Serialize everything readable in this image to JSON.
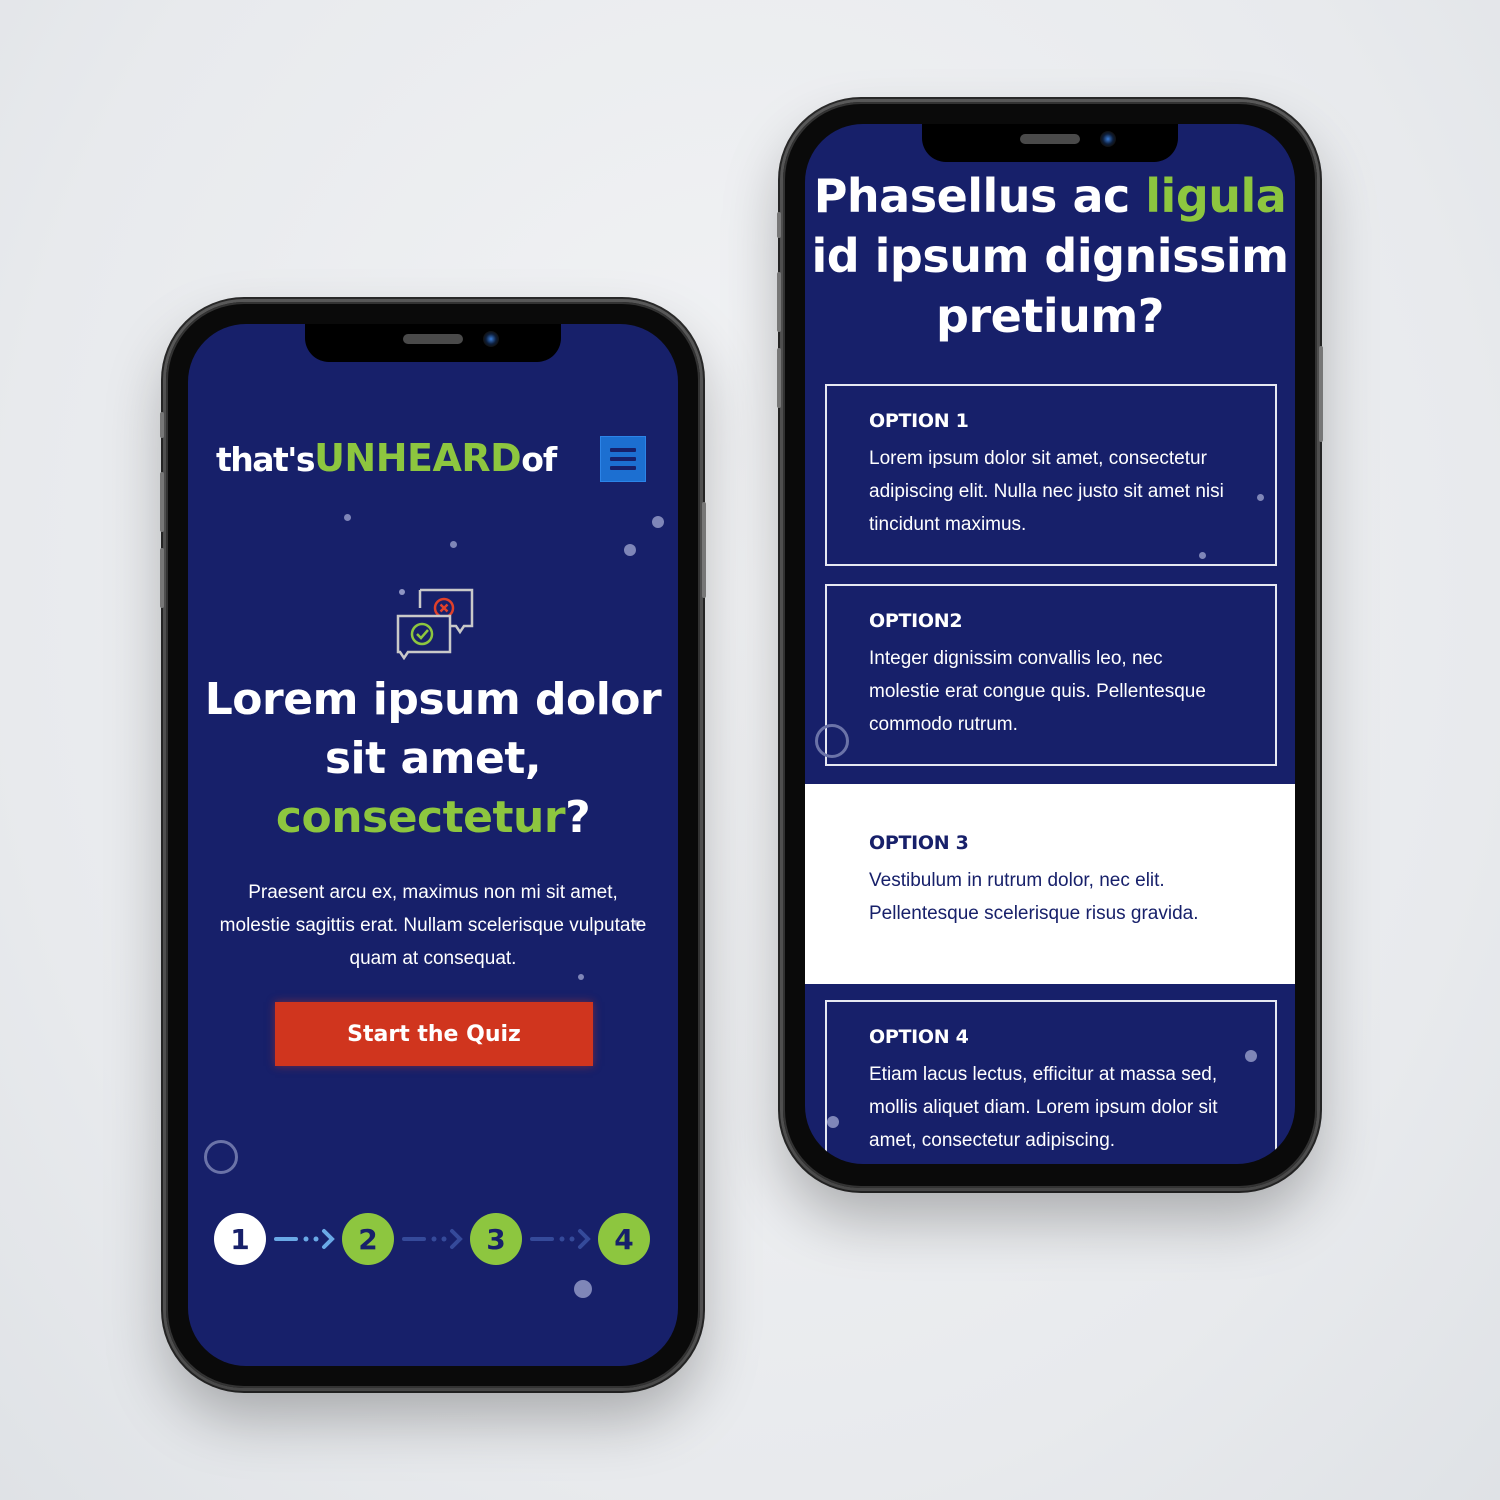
{
  "colors": {
    "screen_bg": "#17206a",
    "accent_green": "#8dc63f",
    "cta_red": "#d0351e",
    "menu_blue": "#1c6fd1",
    "white": "#ffffff"
  },
  "landing": {
    "logo": {
      "part1": "that's",
      "part2": "UNHEARD",
      "part3": "of"
    },
    "menu_icon": "hamburger-icon",
    "hero_icon": "chat-check-cross-icon",
    "title_line1": "Lorem ipsum dolor",
    "title_line2": "sit amet,",
    "title_highlight": "consectetur",
    "title_end": "?",
    "body": "Praesent arcu ex, maximus non mi sit amet, molestie sagittis erat. Nullam scelerisque vulputate quam at consequat.",
    "cta_label": "Start the Quiz",
    "steps": [
      {
        "label": "1",
        "state": "current"
      },
      {
        "label": "2",
        "state": "upcoming"
      },
      {
        "label": "3",
        "state": "upcoming"
      },
      {
        "label": "4",
        "state": "upcoming"
      }
    ]
  },
  "question": {
    "title_part1": "Phasellus ac",
    "title_highlight": "ligula",
    "title_part2": "id ipsum dignissim pretium?",
    "options": [
      {
        "label": "OPTION 1",
        "text": "Lorem ipsum dolor sit amet, consectetur adipiscing elit. Nulla nec justo sit amet nisi tincidunt maximus.",
        "selected": false
      },
      {
        "label": "OPTION2",
        "text": "Integer dignissim convallis leo, nec molestie erat congue quis. Pellentesque commodo rutrum.",
        "selected": false
      },
      {
        "label": "OPTION 3",
        "text": "Vestibulum in rutrum dolor, nec elit. Pellentesque scelerisque risus gravida.",
        "selected": true
      },
      {
        "label": "OPTION 4",
        "text": "Etiam lacus lectus, efficitur at massa sed, mollis aliquet diam. Lorem ipsum dolor sit amet, consectetur adipiscing.",
        "selected": false
      }
    ]
  }
}
